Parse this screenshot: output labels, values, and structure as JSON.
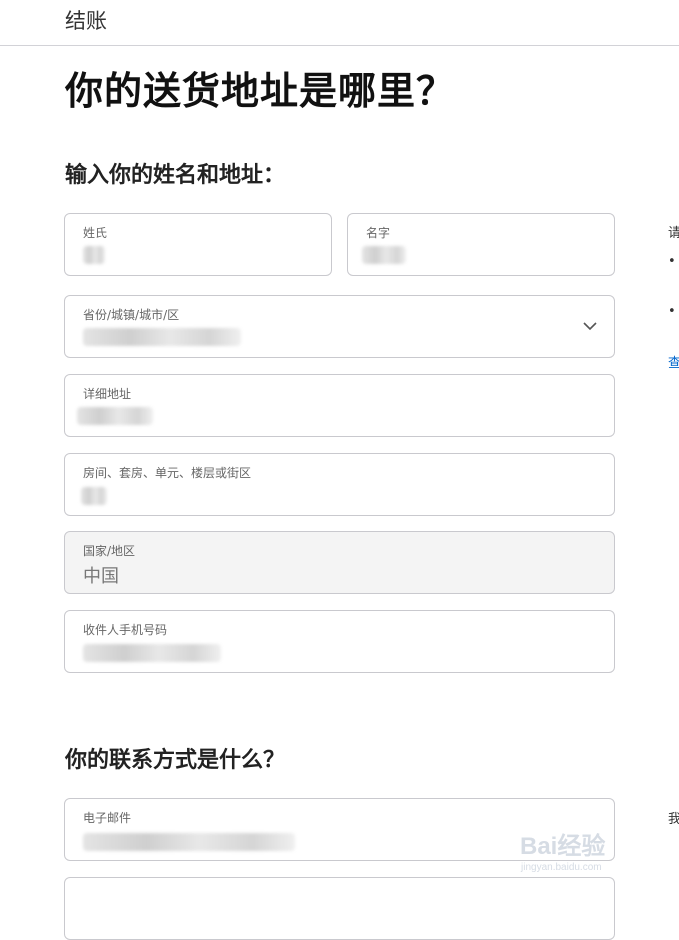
{
  "header": {
    "title": "结账"
  },
  "page_title": "你的送货地址是哪里？",
  "section_address": {
    "title": "输入你的姓名和地址："
  },
  "fields": {
    "last_name": {
      "label": "姓氏"
    },
    "first_name": {
      "label": "名字"
    },
    "region": {
      "label": "省份/城镇/城市/区"
    },
    "street": {
      "label": "详细地址"
    },
    "unit": {
      "label": "房间、套房、单元、楼层或街区"
    },
    "country": {
      "label": "国家/地区",
      "value": "中国"
    },
    "phone": {
      "label": "收件人手机号码"
    },
    "email": {
      "label": "电子邮件"
    }
  },
  "section_contact": {
    "title": "你的联系方式是什么？"
  },
  "side": {
    "line1": "请",
    "bullet": "•",
    "link": "查",
    "line2": "我"
  },
  "watermark": {
    "main": "Bai经验",
    "sub": "jingyan.baidu.com"
  },
  "icons": {
    "region_dropdown": "chevron-down-icon"
  }
}
